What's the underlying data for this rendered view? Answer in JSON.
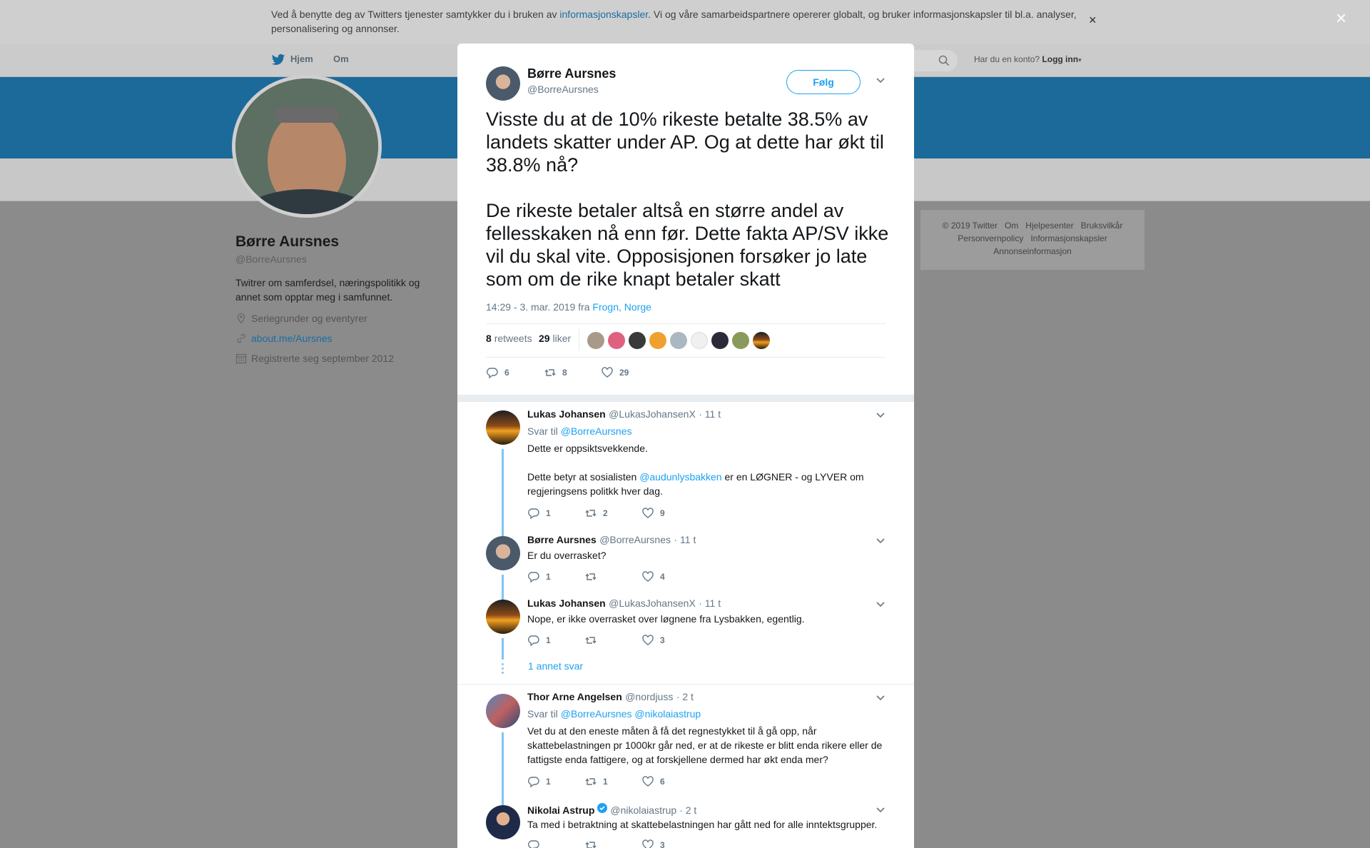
{
  "cookie_bar": {
    "text_before": "Ved å benytte deg av Twitters tjenester samtykker du i bruken av ",
    "link": "informasjonskapsler",
    "text_after": ". Vi og våre samarbeidspartnere opererer globalt, og bruker informasjonskapsler til bl.a. analyser, personalisering og annonser.",
    "close": "×"
  },
  "topnav": {
    "home": "Hjem",
    "about": "Om",
    "have_account": "Har du en konto?",
    "login": "Logg inn"
  },
  "profile": {
    "name": "Børre Aursnes",
    "handle": "@BorreAursnes",
    "bio": "Twitrer om samferdsel, næringspolitikk og annet som opptar meg i samfunnet.",
    "location": "Seriegrunder og eventyrer",
    "link": "about.me/Aursnes",
    "joined": "Registrerte seg september 2012"
  },
  "footer": {
    "line1": "© 2019 Twitter   Om   Hjelpesenter   Bruksvilkår",
    "line2": "Personvernpolicy   Informasjonskapsler",
    "line3": "Annonseinformasjon"
  },
  "overlay_close": "×",
  "tweet": {
    "author_name": "Børre Aursnes",
    "author_handle": "@BorreAursnes",
    "follow": "Følg",
    "para1": "Visste du at de 10% rikeste betalte 38.5% av landets skatter under AP. Og at dette har økt til 38.8% nå?",
    "para2": "De rikeste betaler altså en større andel av fellesskaken nå enn før. Dette fakta AP/SV ikke vil du skal vite. Opposisjonen forsøker jo late som om de rike knapt betaler skatt",
    "timestamp": "14:29 - 3. mar. 2019 fra ",
    "location": "Frogn, Norge",
    "retweets_count": "8",
    "retweets_label": "retweets",
    "likes_count": "29",
    "likes_label": "liker",
    "replies": "6",
    "rts": "8",
    "likes": "29"
  },
  "replies": [
    {
      "name": "Lukas Johansen",
      "handle": "@LukasJohansenX",
      "time": "· 11 t",
      "reply_prefix": "Svar til ",
      "reply_to": "@BorreAursnes",
      "line1": "Dette er oppsiktsvekkende.",
      "line2_before": "Dette betyr at sosialisten ",
      "line2_mention": "@audunlysbakken",
      "line2_after": " er en LØGNER - og LYVER om regjeringsens politkk hver dag.",
      "replies": "1",
      "rts": "2",
      "likes": "9"
    },
    {
      "name": "Børre Aursnes",
      "handle": "@BorreAursnes",
      "time": "· 11 t",
      "text": "Er du overrasket?",
      "replies": "1",
      "rts": "",
      "likes": "4"
    },
    {
      "name": "Lukas Johansen",
      "handle": "@LukasJohansenX",
      "time": "· 11 t",
      "text": "Nope, er ikke overrasket over løgnene fra Lysbakken, egentlig.",
      "replies": "1",
      "rts": "",
      "likes": "3"
    },
    {
      "name": "Thor Arne Angelsen",
      "handle": "@nordjuss",
      "time": "· 2 t",
      "reply_prefix": "Svar til ",
      "reply_to": "@BorreAursnes @nikolaiastrup",
      "text": "Vet du at den eneste måten å få det regnestykket til å gå opp, når skattebelastningen pr 1000kr går ned, er at de rikeste er blitt enda rikere eller de fattigste enda fattigere, og at forskjellene dermed har økt enda mer?",
      "replies": "1",
      "rts": "1",
      "likes": "6"
    },
    {
      "name": "Nikolai Astrup",
      "handle": "@nikolaiastrup",
      "time": "· 2 t",
      "text": "Ta med i betraktning at skattebelastningen har gått ned for alle inntektsgrupper.",
      "replies": "",
      "rts": "",
      "likes": "3"
    }
  ],
  "more_replies": "1 annet svar"
}
